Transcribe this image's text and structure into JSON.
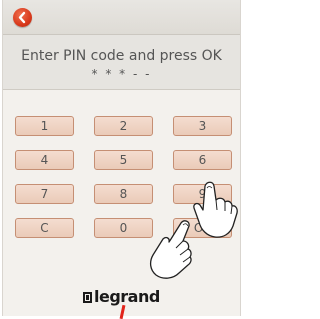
{
  "header": {
    "back_icon": "back-arrow-icon",
    "accent_color": "#d8391c"
  },
  "prompt": {
    "text": "Enter PIN code and press OK",
    "pin_mask": "* * * - -"
  },
  "keypad": {
    "keys": [
      "1",
      "2",
      "3",
      "4",
      "5",
      "6",
      "7",
      "8",
      "9",
      "C",
      "0",
      "OK"
    ]
  },
  "brand": {
    "logo": "legrand"
  },
  "colors": {
    "key_fill": "#f0d4c4",
    "key_border": "#c58f74",
    "brand_red": "#e2231a"
  }
}
